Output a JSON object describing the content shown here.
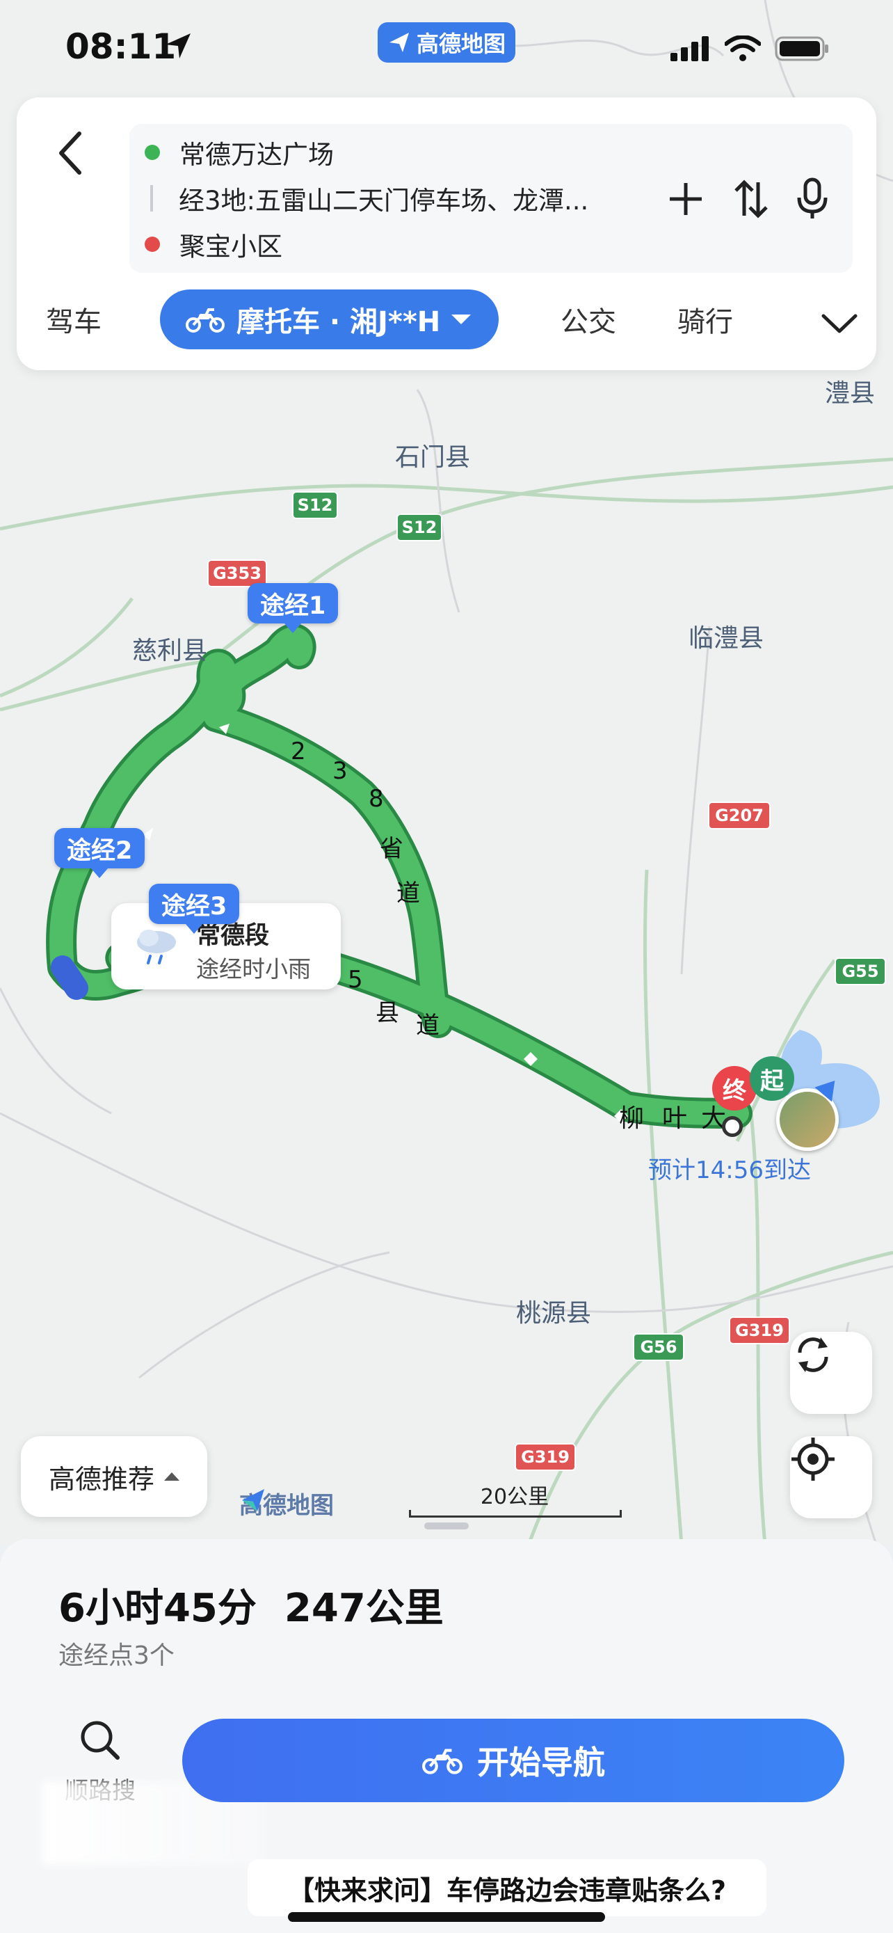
{
  "status_bar": {
    "time": "08:11",
    "app_badge": "高德地图"
  },
  "route_inputs": {
    "origin": "常德万达广场",
    "waypoints": "经3地:五雷山二天门停车场、龙潭...",
    "destination": "聚宝小区"
  },
  "mode_tabs": {
    "drive": "驾车",
    "motorcycle": "摩托车 · 湘J**H",
    "transit": "公交",
    "cycle": "骑行"
  },
  "map": {
    "places": [
      "澧县",
      "石门县",
      "临澧县",
      "慈利县",
      "桃源县"
    ],
    "road_shields": [
      "S12",
      "S12",
      "G353",
      "G207",
      "G55",
      "G56",
      "G319",
      "G319"
    ],
    "route_label_1": [
      "2",
      "3",
      "8",
      "省",
      "道"
    ],
    "route_label_2": [
      "5",
      "县",
      "道"
    ],
    "route_label_3": [
      "柳",
      "叶",
      "大"
    ],
    "via_1": "途经1",
    "via_2": "途经2",
    "via_3": "途经3",
    "weather_segment": "常德段",
    "weather_text": "途经时小雨",
    "end_pin": "终",
    "start_pin": "起",
    "eta": "预计14:56到达",
    "recommend": "高德推荐",
    "logo": "高德地图",
    "scale": "20公里",
    "colors": {
      "route": "#3dad5b",
      "route_outline": "#2a8a45",
      "accent": "#3a7bea"
    }
  },
  "summary": {
    "duration": "6小时45分",
    "distance": "247公里",
    "waypoint_count": "途经点3个"
  },
  "actions": {
    "search_along": "顺路搜",
    "start_nav": "开始导航"
  },
  "banner": "【快来求问】车停路边会违章贴条么?"
}
